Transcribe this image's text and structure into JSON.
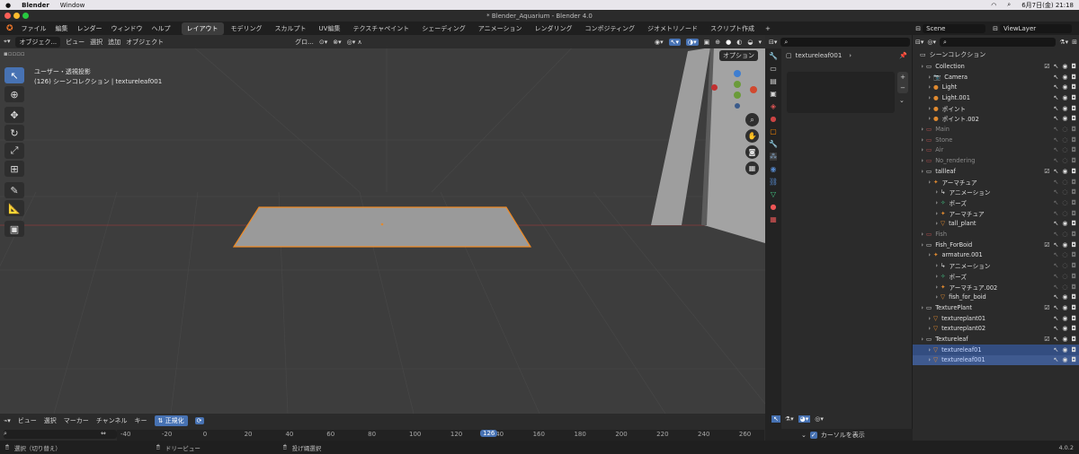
{
  "macos": {
    "app": "Blender",
    "menu": "Window",
    "datetime": "6月7日(金) 21:18"
  },
  "window_title": "* Blender_Aquarium - Blender 4.0",
  "menus": [
    "ファイル",
    "編集",
    "レンダー",
    "ウィンドウ",
    "ヘルプ"
  ],
  "workspaces": [
    "レイアウト",
    "モデリング",
    "スカルプト",
    "UV編集",
    "テクスチャペイント",
    "シェーディング",
    "アニメーション",
    "レンダリング",
    "コンポジティング",
    "ジオメトリノード",
    "スクリプト作成"
  ],
  "scene": "Scene",
  "view_layer": "ViewLayer",
  "viewport": {
    "mode": "オブジェク...",
    "menus": [
      "ビュー",
      "選択",
      "追加",
      "オブジェクト"
    ],
    "transform": "グロ...",
    "options": "オプション",
    "view_label": "ユーザー・透視投影",
    "collection_label": "(126) シーンコレクション | textureleaf001"
  },
  "properties": {
    "object_name": "textureleaf001"
  },
  "outliner": {
    "title": "シーンコレクション",
    "rows": [
      {
        "label": "Collection",
        "indent": 1,
        "kind": "coll",
        "check": true,
        "eye": true
      },
      {
        "label": "Camera",
        "indent": 2,
        "kind": "cam",
        "eye": true
      },
      {
        "label": "Light",
        "indent": 2,
        "kind": "light",
        "eye": true
      },
      {
        "label": "Light.001",
        "indent": 2,
        "kind": "light",
        "eye": true
      },
      {
        "label": "ポイント",
        "indent": 2,
        "kind": "light",
        "eye": true
      },
      {
        "label": "ポイント.002",
        "indent": 2,
        "kind": "light",
        "eye": true
      },
      {
        "label": "Main",
        "indent": 1,
        "kind": "coll-off",
        "eye": false
      },
      {
        "label": "Stone",
        "indent": 1,
        "kind": "coll-off",
        "eye": false
      },
      {
        "label": "Air",
        "indent": 1,
        "kind": "coll-off",
        "eye": false
      },
      {
        "label": "No_rendering",
        "indent": 1,
        "kind": "coll-off",
        "eye": false
      },
      {
        "label": "tallleaf",
        "indent": 1,
        "kind": "coll",
        "check": true,
        "eye": true
      },
      {
        "label": "アーマチュア",
        "indent": 2,
        "kind": "arm",
        "eye": false
      },
      {
        "label": "アニメーション",
        "indent": 3,
        "kind": "anim",
        "eye": false
      },
      {
        "label": "ポーズ",
        "indent": 3,
        "kind": "pose",
        "eye": false
      },
      {
        "label": "アーマチュア",
        "indent": 3,
        "kind": "arm",
        "eye": false
      },
      {
        "label": "tall_plant",
        "indent": 3,
        "kind": "mesh",
        "eye": true
      },
      {
        "label": "Fish",
        "indent": 1,
        "kind": "coll-off",
        "eye": false
      },
      {
        "label": "Fish_ForBoid",
        "indent": 1,
        "kind": "coll",
        "check": true,
        "eye": true
      },
      {
        "label": "armature.001",
        "indent": 2,
        "kind": "arm",
        "eye": false
      },
      {
        "label": "アニメーション",
        "indent": 3,
        "kind": "anim",
        "eye": false
      },
      {
        "label": "ポーズ",
        "indent": 3,
        "kind": "pose",
        "eye": false
      },
      {
        "label": "アーマチュア.002",
        "indent": 3,
        "kind": "arm",
        "eye": false
      },
      {
        "label": "fish_for_boid",
        "indent": 3,
        "kind": "mesh",
        "eye": true
      },
      {
        "label": "TexturePlant",
        "indent": 1,
        "kind": "coll",
        "check": true,
        "eye": true
      },
      {
        "label": "textureplant01",
        "indent": 2,
        "kind": "mesh",
        "eye": true
      },
      {
        "label": "textureplant02",
        "indent": 2,
        "kind": "mesh",
        "eye": true
      },
      {
        "label": "Textureleaf",
        "indent": 1,
        "kind": "coll",
        "check": true,
        "eye": true
      },
      {
        "label": "textureleaf01",
        "indent": 2,
        "kind": "mesh",
        "eye": true,
        "sel": true
      },
      {
        "label": "textureleaf001",
        "indent": 2,
        "kind": "mesh",
        "eye": true,
        "sel": true
      }
    ]
  },
  "timeline": {
    "menus": [
      "ビュー",
      "選択",
      "マーカー",
      "チャンネル",
      "キー"
    ],
    "normalize": "正規化",
    "current_frame": "126",
    "ticks": [
      "-40",
      "-20",
      "0",
      "20",
      "40",
      "60",
      "80",
      "100",
      "120",
      "140",
      "160",
      "180",
      "200",
      "220",
      "240",
      "260"
    ],
    "only_show": "カーソルを表示"
  },
  "status": {
    "select": "選択（切り替え）",
    "dolly": "ドリービュー",
    "lasso": "投げ縄選択",
    "version": "4.0.2"
  }
}
